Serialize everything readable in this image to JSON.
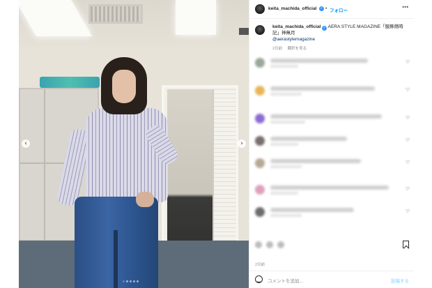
{
  "post": {
    "header": {
      "username": "keita_machida_official",
      "follow_label": "フォロー",
      "separator": "•",
      "more_icon": "⋯"
    },
    "caption": {
      "username": "keita_machida_official",
      "text": "AERA STYLE MAGAZINE「服飾燃時記」神無月",
      "mention": "@aerastylemagazine",
      "age": "2日前",
      "translate": "翻訳を見る"
    },
    "comments_blurred": true,
    "timestamp": "2日前",
    "comment_input": {
      "placeholder": "コメントを追加...",
      "post_label": "投稿する"
    }
  },
  "carousel": {
    "prev_icon": "‹",
    "next_icon": "›",
    "dots": 5,
    "active_dot": 1
  },
  "colors": {
    "accent": "#0095f6",
    "verified": "#3897f0",
    "text": "#262626",
    "muted": "#8e8e8e"
  }
}
